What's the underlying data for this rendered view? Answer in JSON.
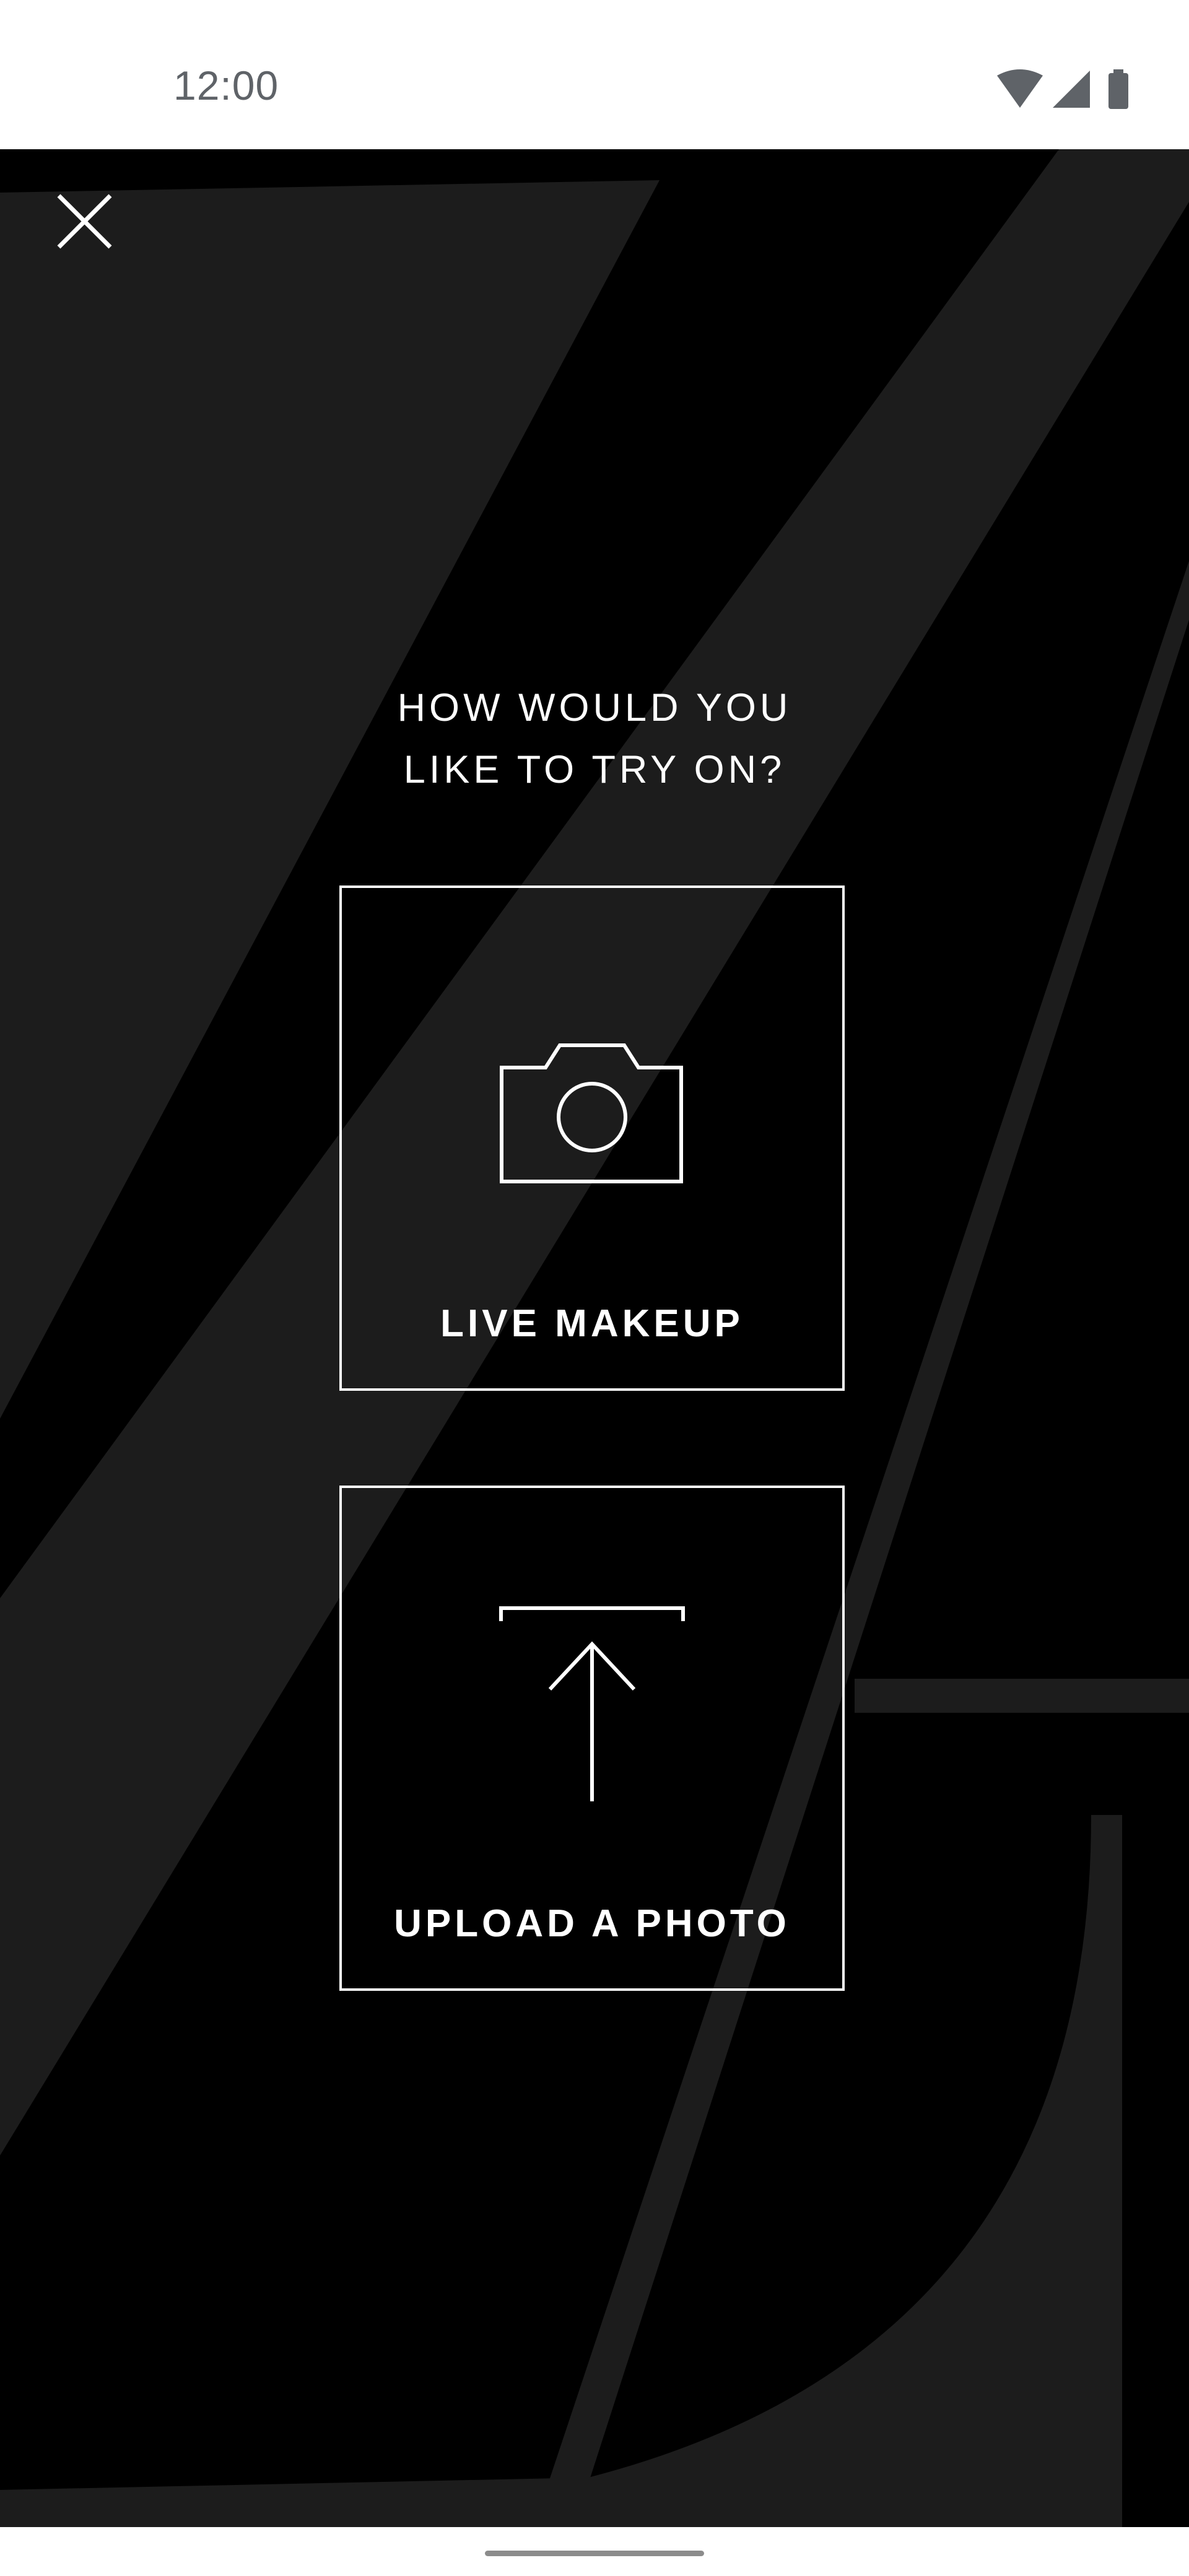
{
  "status_bar": {
    "time": "12:00",
    "icons": [
      "wifi-icon",
      "signal-icon",
      "battery-icon"
    ]
  },
  "dialog": {
    "close_icon": "close-icon",
    "prompt_line_1": "HOW WOULD YOU",
    "prompt_line_2": "LIKE TO TRY ON?",
    "options": [
      {
        "label": "LIVE MAKEUP",
        "icon": "camera-icon"
      },
      {
        "label": "UPLOAD A PHOTO",
        "icon": "upload-icon"
      }
    ]
  },
  "colors": {
    "background": "#000000",
    "background_letter": "#1c1c1c",
    "foreground": "#ffffff",
    "status_text": "#5f6368"
  }
}
